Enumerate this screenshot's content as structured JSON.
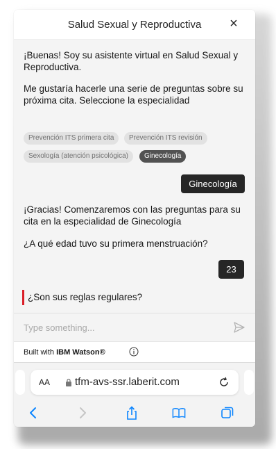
{
  "header": {
    "title": "Salud Sexual y Reproductiva",
    "close_symbol": "×"
  },
  "conversation": {
    "greeting": "¡Buenas! Soy su asistente virtual en Salud Sexual y Reproductiva.",
    "prompt": "Me gustaría hacerle una serie de preguntas sobre su próxima cita. Seleccione la especialidad",
    "options": [
      {
        "label": "Prevención ITS primera cita",
        "selected": false
      },
      {
        "label": "Prevención ITS revisión",
        "selected": false
      },
      {
        "label": "Sexología (atención psicológica)",
        "selected": false
      },
      {
        "label": "Ginecología",
        "selected": true
      }
    ],
    "user_reply_1": "Ginecología",
    "thanks": "¡Gracias! Comenzaremos con las preguntas para su cita en la especialidad de Ginecología",
    "question_1": "¿A qué edad tuvo su primera menstruación?",
    "user_reply_2": "23",
    "current_question": "¿Son sus reglas regulares?"
  },
  "input": {
    "placeholder": "Type something..."
  },
  "footer": {
    "prefix": "Built with ",
    "brand": "IBM Watson®"
  },
  "browser": {
    "text_size": "AA",
    "url": "tfm-avs-ssr.laberit.com"
  },
  "colors": {
    "accent_red": "#da1e28",
    "bubble_dark": "#262626",
    "ios_blue": "#0a84ff"
  }
}
